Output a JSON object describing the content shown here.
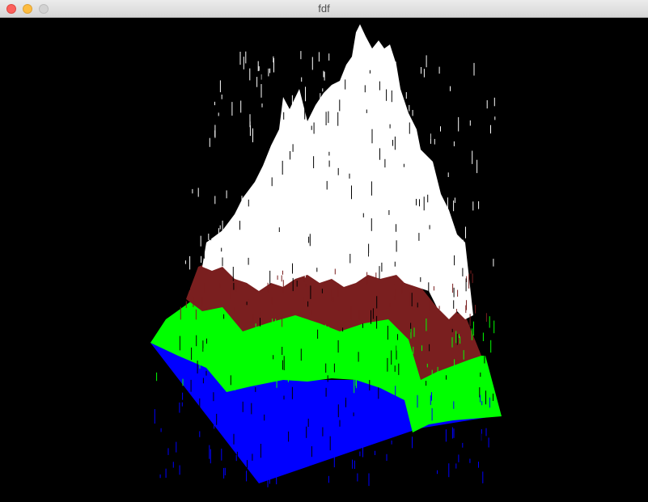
{
  "window": {
    "title": "fdf"
  },
  "render": {
    "background": "#000000",
    "palette": {
      "low": "#0000ff",
      "mid": "#00ff00",
      "high": "#7a1f1f",
      "peak": "#ffffff"
    }
  },
  "icons": {
    "close": "close-icon",
    "minimize": "minimize-icon",
    "zoom": "zoom-icon"
  }
}
